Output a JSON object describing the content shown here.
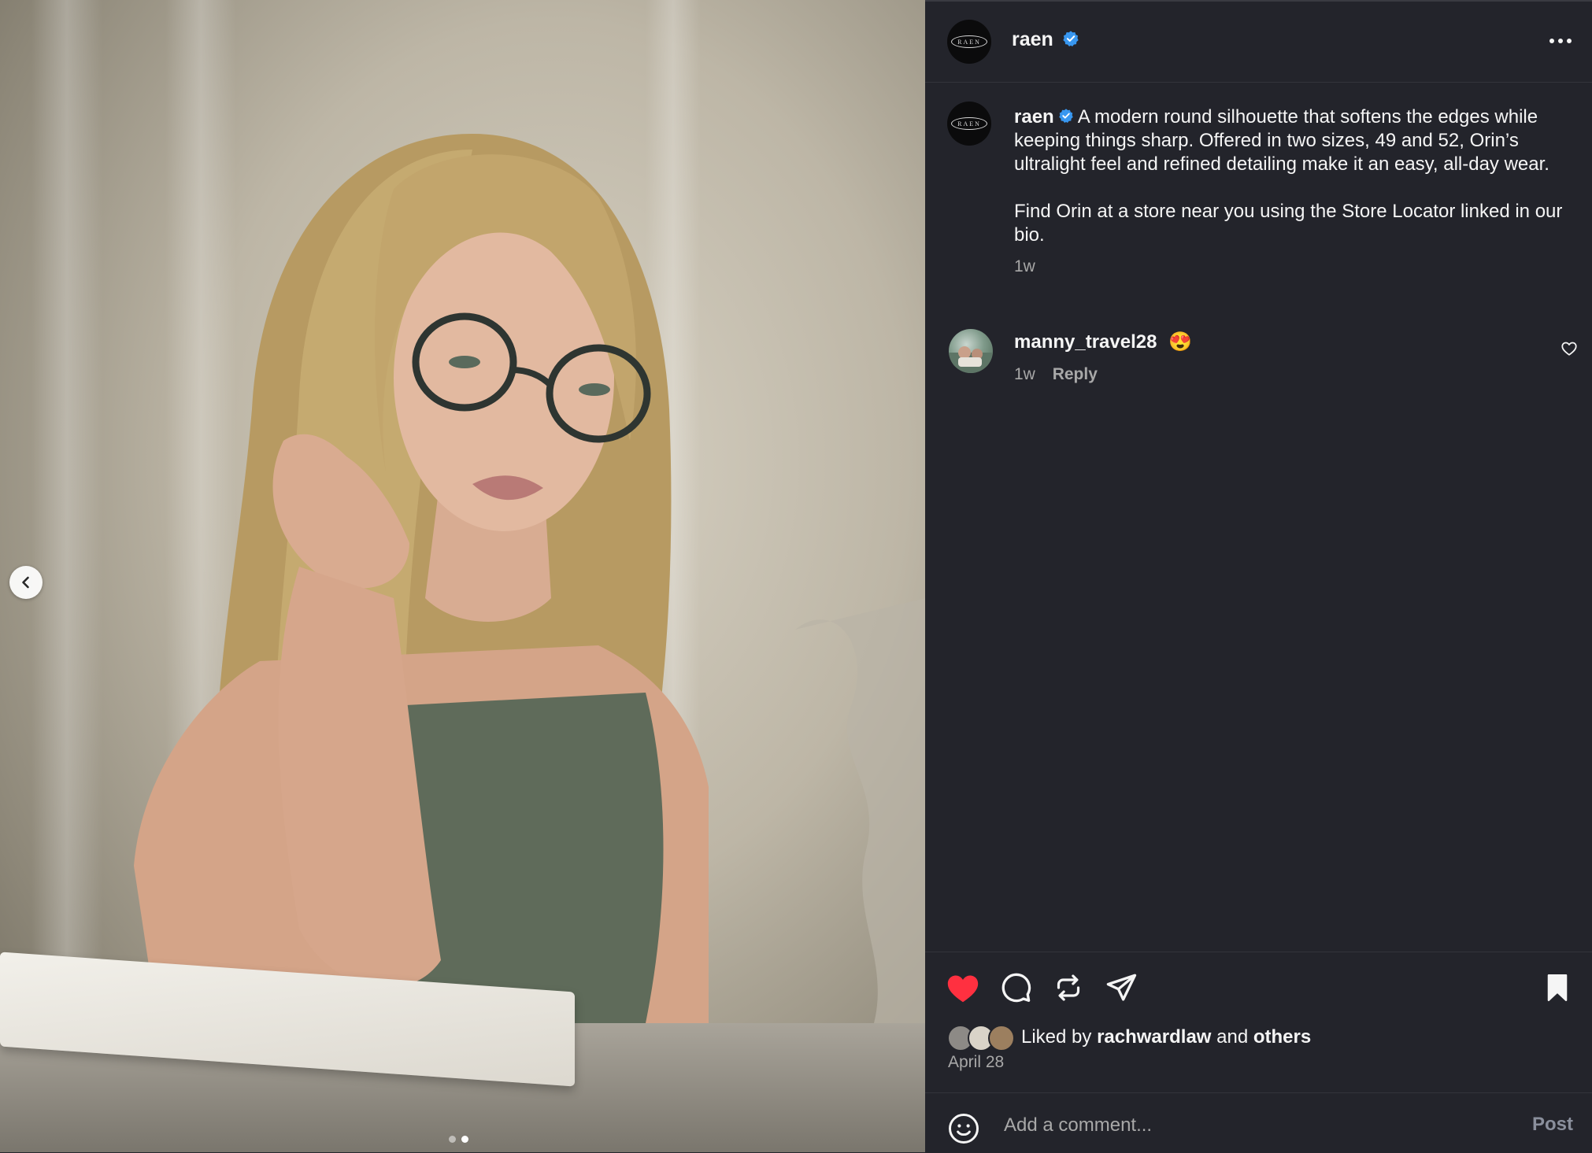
{
  "post": {
    "author": "raen",
    "logo_text": "RAEN",
    "caption_paragraphs": [
      "A modern round silhouette that softens the edges while keeping things sharp. Offered in two sizes, 49 and 52, Orin’s ultralight feel and refined detailing make it an easy, all-day wear.",
      "Find Orin at a store near you using the Store Locator linked in our bio."
    ],
    "caption_time": "1w",
    "date": "April 28"
  },
  "comments": [
    {
      "user": "manny_travel28",
      "text": "😍",
      "time": "1w",
      "reply_label": "Reply"
    }
  ],
  "likes": {
    "prefix": "Liked by",
    "user": "rachwardlaw",
    "joiner": "and",
    "others": "others"
  },
  "composer": {
    "placeholder": "Add a comment...",
    "post_label": "Post"
  },
  "carousel": {
    "slide_count": 2,
    "active_slide": 2
  },
  "icons": {
    "verified": "verified-badge-icon",
    "more": "more-options-icon",
    "like": "heart-icon",
    "comment": "comment-bubble-icon",
    "repost": "repost-icon",
    "share": "paper-plane-icon",
    "save": "bookmark-icon",
    "emoji": "emoji-icon",
    "prev": "chevron-left-icon"
  },
  "colors": {
    "background": "#23242b",
    "text": "#f5f5f5",
    "muted": "#a8a8a8",
    "like_active": "#ff3040",
    "verified": "#3897f0"
  }
}
